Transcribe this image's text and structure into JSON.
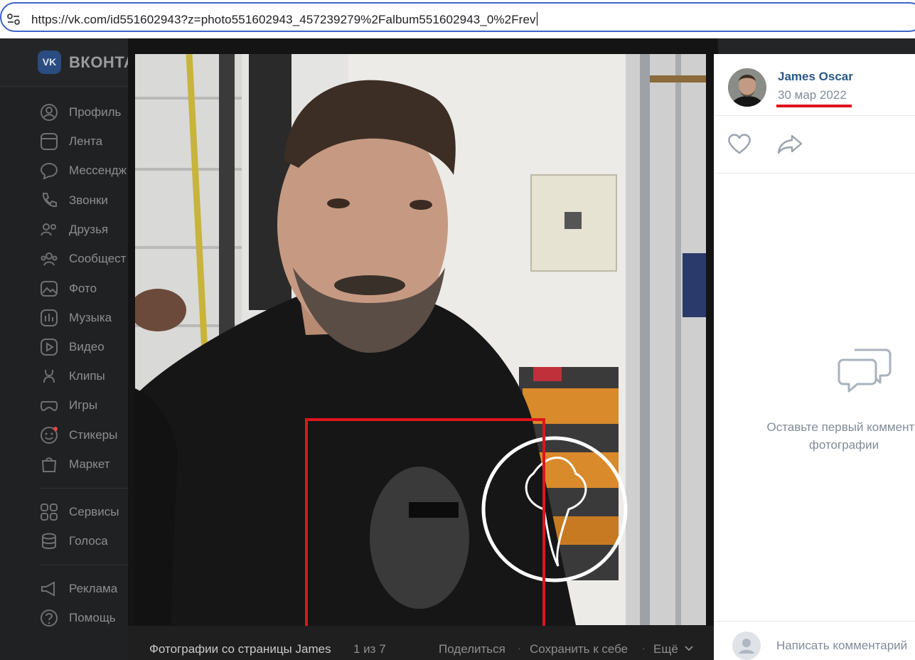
{
  "browser": {
    "url": "https://vk.com/id551602943?z=photo551602943_457239279%2Falbum551602943_0%2Frev"
  },
  "vk": {
    "brand": "ВКОНТА",
    "logo_text": "VK",
    "nav": [
      {
        "label": "Профиль",
        "icon": "profile-icon"
      },
      {
        "label": "Лента",
        "icon": "feed-icon"
      },
      {
        "label": "Мессендж",
        "icon": "messenger-icon"
      },
      {
        "label": "Звонки",
        "icon": "phone-icon"
      },
      {
        "label": "Друзья",
        "icon": "friends-icon"
      },
      {
        "label": "Сообщест",
        "icon": "communities-icon"
      },
      {
        "label": "Фото",
        "icon": "photo-icon"
      },
      {
        "label": "Музыка",
        "icon": "music-icon"
      },
      {
        "label": "Видео",
        "icon": "video-icon"
      },
      {
        "label": "Клипы",
        "icon": "clips-icon"
      },
      {
        "label": "Игры",
        "icon": "games-icon"
      },
      {
        "label": "Стикеры",
        "icon": "stickers-icon"
      },
      {
        "label": "Маркет",
        "icon": "market-icon"
      },
      {
        "label": "Сервисы",
        "icon": "services-icon"
      },
      {
        "label": "Голоса",
        "icon": "votes-icon"
      },
      {
        "label": "Реклама",
        "icon": "ads-icon"
      },
      {
        "label": "Помощь",
        "icon": "help-icon"
      }
    ]
  },
  "viewer": {
    "album_label": "Фотографии со страницы James",
    "counter": "1 из 7",
    "share": "Поделиться",
    "save": "Сохранить к себе",
    "more": "Ещё"
  },
  "panel": {
    "author": "James Oscar",
    "date": "30 мар 2022",
    "empty_line1": "Оставьте первый коммента",
    "empty_line2": "фотографии",
    "comment_placeholder": "Написать комментарий"
  },
  "colors": {
    "link": "#2a5885",
    "highlight": "#e0141e",
    "url_border": "#3f64c6"
  }
}
